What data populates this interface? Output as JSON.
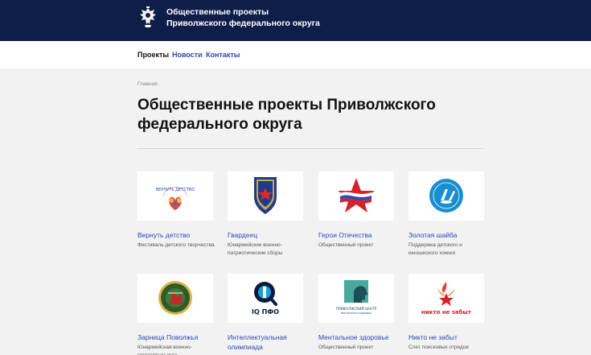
{
  "header": {
    "title_line1": "Общественные проекты",
    "title_line2": "Приволжского федерального округа",
    "emblem_icon": "double-headed-eagle-icon",
    "background_color": "#0e1e49"
  },
  "nav": {
    "items": [
      {
        "label": "Проекты",
        "active": true
      },
      {
        "label": "Новости",
        "active": false
      },
      {
        "label": "Контакты",
        "active": false
      }
    ],
    "link_color": "#2c47b6"
  },
  "breadcrumb": "Главная",
  "page_title": "Общественные проекты Приволжского федерального округа",
  "projects": [
    {
      "title": "Вернуть детство",
      "description": "Фестиваль детского творчества",
      "logo_text": "ВЕРНУТЬ ДЕТСТВО",
      "icon": "family-heart-logo-icon"
    },
    {
      "title": "Гвардеец",
      "description": "Юнармейские военно-патриотические сборы",
      "icon": "guard-shield-star-logo-icon"
    },
    {
      "title": "Герои Отечества",
      "description": "Общественный проект",
      "icon": "red-star-flag-logo-icon"
    },
    {
      "title": "Золотая шайба",
      "description": "Поддержка детского и юношеского хоккея",
      "icon": "hockey-round-logo-icon"
    },
    {
      "title": "Зарница Поволжья",
      "description": "Юнармейская военно-спортивная игра",
      "icon": "zarnitsa-round-logo-icon"
    },
    {
      "title": "Интеллектуальная олимпиада",
      "description": "",
      "logo_text": "IQ ПФО",
      "icon": "iq-magnifier-logo-icon"
    },
    {
      "title": "Ментальное здоровье",
      "description": "Общественный проект",
      "logo_text": "ПРИВОЛЖСКИЙ ЦЕНТР",
      "logo_subtext": "ментального здоровья",
      "icon": "head-profile-logo-icon"
    },
    {
      "title": "Никто не забыт",
      "description": "Слет поисковых отрядов",
      "logo_text": "никто не забыт",
      "icon": "eternal-flame-star-logo-icon"
    }
  ]
}
